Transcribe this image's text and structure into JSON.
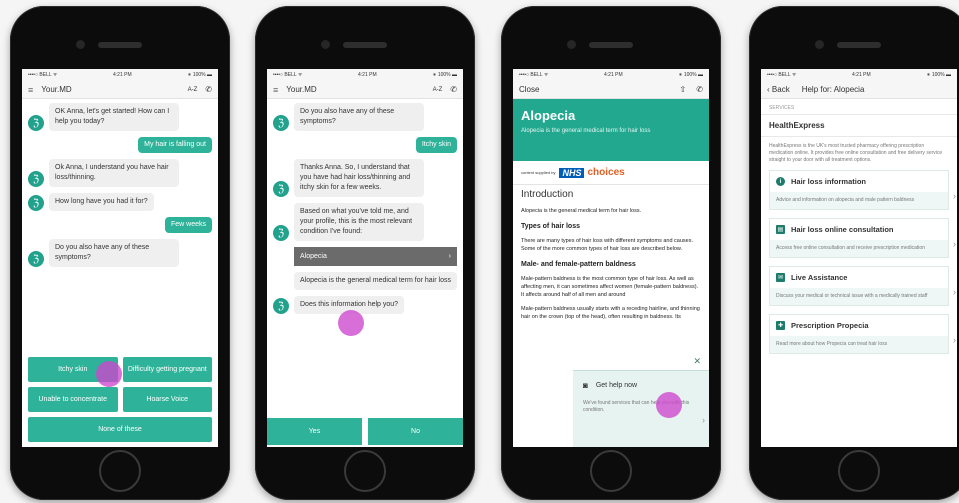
{
  "status": {
    "carrier": "••••○ BELL ᯤ",
    "time": "4:21 PM",
    "battery": "∗ 100% ▬"
  },
  "screen1": {
    "app_title": "Your.MD",
    "az_label": "A-Z",
    "messages": [
      {
        "from": "bot",
        "text": "OK Anna, let's get started! How can I help you today?"
      },
      {
        "from": "user",
        "text": "My hair is falling out"
      },
      {
        "from": "bot",
        "text": "Ok Anna, I understand you have hair loss/thinning."
      },
      {
        "from": "bot",
        "text": "How long have you had it for?"
      },
      {
        "from": "user",
        "text": "Few weeks"
      },
      {
        "from": "bot",
        "text": "Do you also have any of these symptoms?"
      }
    ],
    "options": [
      "Itchy skin",
      "Difficulty getting pregnant",
      "Unable to concentrate",
      "Hoarse Voice",
      "None of these"
    ]
  },
  "screen2": {
    "app_title": "Your.MD",
    "az_label": "A-Z",
    "q1": "Do you also have any of these symptoms?",
    "answer": "Itchy skin",
    "summary": "Thanks Anna. So, I understand that you have had hair loss/thinning and itchy skin for a few weeks.",
    "based": "Based on what you've told me, and your profile, this is the most relevant condition I've found:",
    "condition": "Alopecia",
    "condition_desc": "Alopecia is the general medical term for hair loss",
    "q2": "Does this information help you?",
    "yes": "Yes",
    "no": "No"
  },
  "screen3": {
    "close": "Close",
    "title": "Alopecia",
    "subtitle": "Alopecia is the general medical term for hair loss",
    "supplied_by": "content supplied by",
    "nhs": "NHS",
    "choices": "choices",
    "intro_heading": "Introduction",
    "intro_text": "Alopecia is the general medical term for hair loss.",
    "types_heading": "Types of hair loss",
    "types_text": "There are many types of hair loss with different symptoms and causes. Some of the more common types of hair loss are described below.",
    "male_heading": "Male- and female-pattern baldness",
    "male_text": "Male-pattern baldness is the most common type of hair loss. As well as affecting men, it can sometimes affect women (female-pattern baldness). It affects around half of all men and around",
    "male_text2": "Male-pattern baldness usually starts with a receding hairline, and thinning hair on the crown (top of the head), often resulting in baldness. Its",
    "help_title": "Get help now",
    "help_text": "We've found services that can help you with this condition."
  },
  "screen4": {
    "back": "Back",
    "title": "Help for: Alopecia",
    "section": "SERVICES",
    "provider": "HealthExpress",
    "provider_desc": "HealthExpress is the UK's most trusted pharmacy offering prescription medication online. It provides free online consultation and free delivery service straight to your door with all treatment options.",
    "services": [
      {
        "icon": "info-icon",
        "glyph": "i",
        "title": "Hair loss information",
        "desc": "Advice and information on alopecia and male pattern baldness"
      },
      {
        "icon": "clipboard-icon",
        "glyph": "▤",
        "title": "Hair loss online consultation",
        "desc": "Access free online consultation and receive prescription medication"
      },
      {
        "icon": "chat-icon",
        "glyph": "✉",
        "title": "Live Assistance",
        "desc": "Discuss your medical or technical issue with a medically trained staff"
      },
      {
        "icon": "pill-icon",
        "glyph": "✚",
        "title": "Prescription Propecia",
        "desc": "Read more about how Propecia can treat hair loss"
      }
    ]
  },
  "colors": {
    "accent": "#2eb39a",
    "hero": "#23a890",
    "nhs_blue": "#005eb8",
    "choices_orange": "#e15f25",
    "touch": "#cd46cd"
  }
}
